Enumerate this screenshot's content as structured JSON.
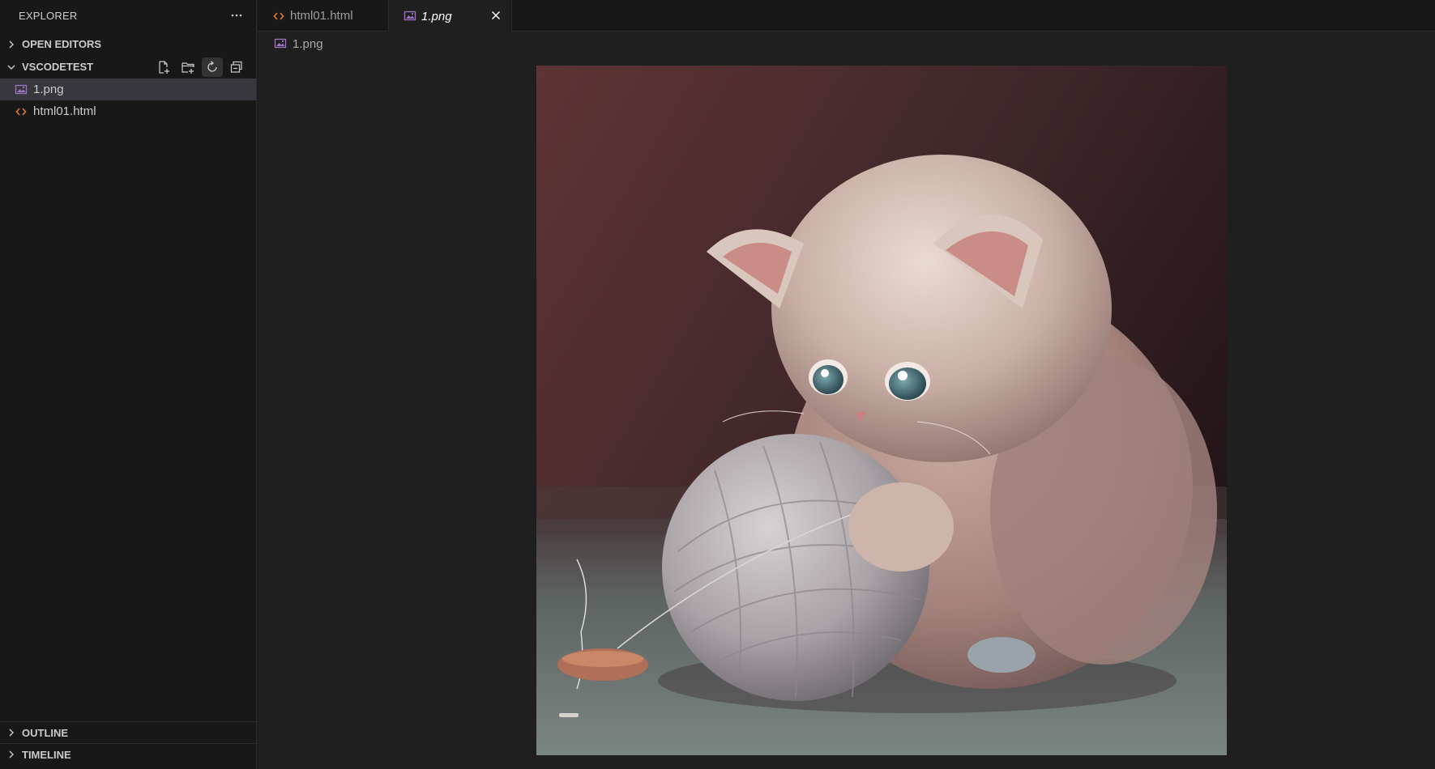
{
  "sidebar": {
    "title": "EXPLORER",
    "more_icon": "ellipsis-icon",
    "sections": {
      "open_editors": "OPEN EDITORS",
      "project": "VSCODETEST",
      "outline": "OUTLINE",
      "timeline": "TIMELINE"
    },
    "project_actions": [
      "new-file-icon",
      "new-folder-icon",
      "refresh-icon",
      "collapse-all-icon"
    ],
    "files": [
      {
        "name": "1.png",
        "icon": "image-file-icon",
        "selected": true
      },
      {
        "name": "html01.html",
        "icon": "html-file-icon",
        "selected": false
      }
    ]
  },
  "tabs": [
    {
      "label": "html01.html",
      "icon": "html-file-icon",
      "active": false
    },
    {
      "label": "1.png",
      "icon": "image-file-icon",
      "active": true,
      "preview": true
    }
  ],
  "breadcrumb": {
    "file": "1.png"
  },
  "colors": {
    "sidebar_bg": "#181818",
    "editor_bg": "#1f1f1f",
    "selected_row": "#37373d",
    "html_icon": "#e37933",
    "image_icon": "#a074c4"
  }
}
